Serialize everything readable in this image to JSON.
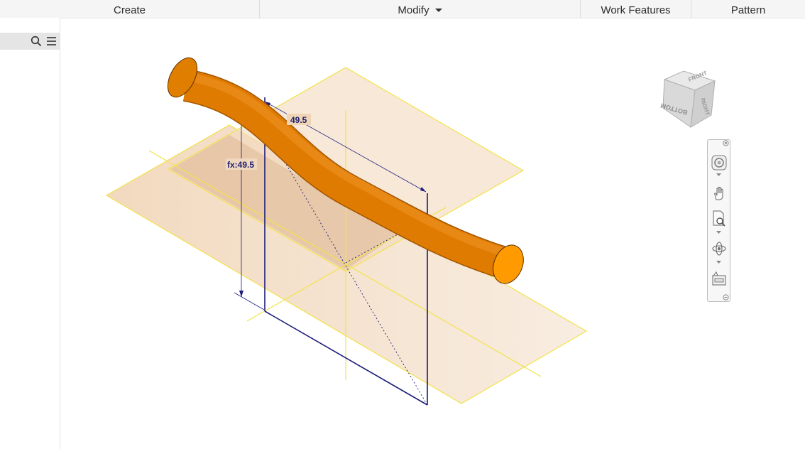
{
  "ribbon": {
    "panels": [
      {
        "label": "Create",
        "has_dropdown": false
      },
      {
        "label": "Modify",
        "has_dropdown": true
      },
      {
        "label": "Work Features",
        "has_dropdown": false
      },
      {
        "label": "Pattern",
        "has_dropdown": false
      }
    ]
  },
  "browser": {
    "icons": [
      "search-icon",
      "menu-icon"
    ]
  },
  "canvas": {
    "dimensions": {
      "horizontal_value": "49.5",
      "vertical_value": "fx:49.5"
    },
    "colors": {
      "sweep_body": "#f08c00",
      "work_plane": "#f3dcc4",
      "work_plane_edge": "#f2e34a",
      "sketch_line": "#1c1c7a"
    }
  },
  "view_cube": {
    "faces": [
      "FRONT",
      "RIGHT",
      "BOTTOM"
    ]
  },
  "navigation_bar": {
    "tools": [
      "steering-wheel-icon",
      "pan-icon",
      "zoom-icon",
      "orbit-icon",
      "look-at-icon"
    ]
  }
}
